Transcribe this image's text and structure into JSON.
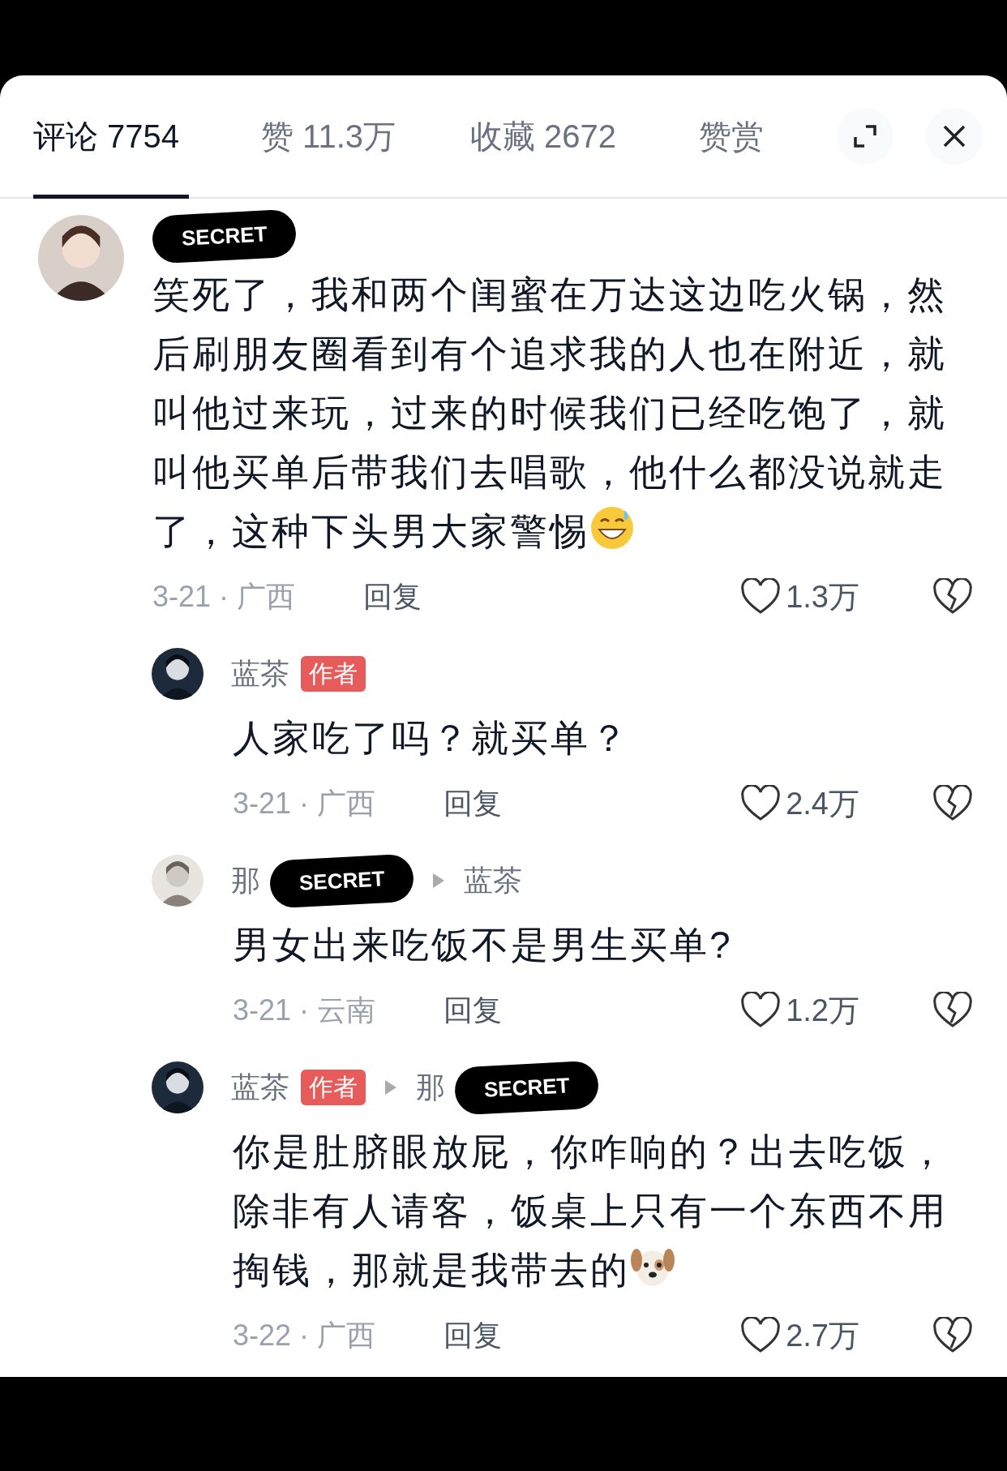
{
  "tabs": [
    {
      "label": "评论 7754",
      "selected": true
    },
    {
      "label": "赞 11.3万",
      "selected": false
    },
    {
      "label": "收藏 2672",
      "selected": false
    },
    {
      "label": "赞赏",
      "selected": false
    }
  ],
  "comment": {
    "author": [
      {
        "kind": "redaction",
        "text": "SECRET"
      }
    ],
    "text": "笑死了，我和两个闺蜜在万达这边吃火锅，然后刷朋友圈看到有个追求我的人也在附近，就叫他过来玩，过来的时候我们已经吃饱了，就叫他买单后带我们去唱歌，他什么都没说就走了，这种下头男大家警惕",
    "emoji": {
      "kind": "sweat"
    },
    "date": "3-21 · 广西",
    "reply": "回复",
    "likes": "1.3万"
  },
  "replies": [
    {
      "author": [
        {
          "kind": "text",
          "text": "蓝茶"
        }
      ],
      "badge": "作者",
      "text": "人家吃了吗？就买单？",
      "date": "3-21 · 广西",
      "reply": "回复",
      "likes": "2.4万"
    },
    {
      "author": [
        {
          "kind": "text",
          "text": "那"
        },
        {
          "kind": "redaction",
          "text": "SECRET"
        }
      ],
      "reply_to": [
        {
          "kind": "text",
          "text": "蓝茶"
        }
      ],
      "text": "男女出来吃饭不是男生买单?",
      "date": "3-21 · 云南",
      "reply": "回复",
      "likes": "1.2万"
    },
    {
      "author": [
        {
          "kind": "text",
          "text": "蓝茶"
        }
      ],
      "badge": "作者",
      "reply_to": [
        {
          "kind": "text",
          "text": "那"
        },
        {
          "kind": "redaction",
          "text": "SECRET"
        }
      ],
      "text": "你是肚脐眼放屁，你咋响的？出去吃饭，除非有人请客，饭桌上只有一个东西不用掏钱，那就是我带去的",
      "emoji": {
        "kind": "dog"
      },
      "date": "3-22 · 广西",
      "reply": "回复",
      "likes": "2.7万"
    }
  ]
}
